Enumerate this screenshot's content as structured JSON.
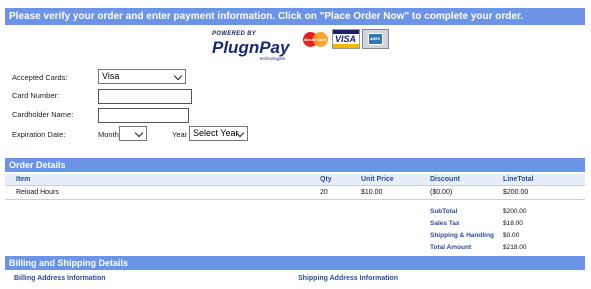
{
  "instruction": "Please verify your order and enter payment information. Click on \"Place Order Now\" to complete your order.",
  "brand": {
    "powered_by": "POWERED BY",
    "name": "PlugnPay",
    "tagline": "technologies"
  },
  "cards": {
    "mastercard": "MasterCard",
    "visa": "VISA",
    "amex": "AMEX"
  },
  "form": {
    "accepted_cards_label": "Accepted Cards:",
    "accepted_cards_value": "Visa",
    "card_number_label": "Card Number:",
    "cardholder_name_label": "Cardholder Name:",
    "expiration_label": "Expiration Date:",
    "month_label": "Month",
    "month_value": "",
    "year_label": "Year",
    "year_value": "Select Year"
  },
  "order": {
    "title": "Order Details",
    "columns": {
      "item": "Item",
      "qty": "Qty",
      "unit_price": "Unit Price",
      "discount": "Discount",
      "line_total": "LineTotal"
    },
    "rows": [
      {
        "item": "Reload Hours",
        "qty": "20",
        "unit_price": "$10.00",
        "discount": "($0.00)",
        "line_total": "$200.00"
      }
    ],
    "totals": {
      "subtotal_label": "SubTotal",
      "subtotal": "$200.00",
      "tax_label": "Sales Tax",
      "tax": "$18.00",
      "shipping_label": "Shipping & Handling",
      "shipping": "$0.00",
      "total_label": "Total Amount",
      "total": "$218.00"
    }
  },
  "billing": {
    "title": "Billing and Shipping Details",
    "billing_info": "Billing Address Information",
    "shipping_info": "Shipping Address Information"
  },
  "colors": {
    "section_bar": "#6b93e6",
    "header_text": "#2a4d9e"
  }
}
